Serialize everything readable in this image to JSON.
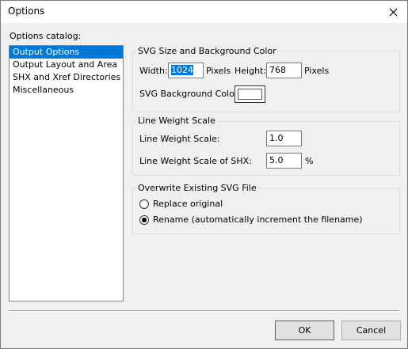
{
  "window": {
    "title": "Options"
  },
  "catalog": {
    "label": "Options catalog:",
    "items": [
      "Output Options",
      "Output Layout and Area",
      "SHX and Xref Directories",
      "Miscellaneous"
    ],
    "selected": "Output Options"
  },
  "svg_size": {
    "title": "SVG Size and Background Color",
    "width_label": "Width:",
    "width_value": "1024",
    "pixels1": "Pixels",
    "height_label": "Height:",
    "height_value": "768",
    "pixels2": "Pixels",
    "bg_label": "SVG Background Color:",
    "bg_color": "#ffffff"
  },
  "line_weight": {
    "title": "Line Weight Scale",
    "scale_label": "Line Weight Scale:",
    "scale_value": "1.0",
    "shx_label": "Line Weight Scale of SHX:",
    "shx_value": "5.0",
    "percent": "%"
  },
  "overwrite": {
    "title": "Overwrite Existing SVG File",
    "option1": "Replace original",
    "option2": "Rename (automatically increment the filename)",
    "selected": "option2"
  },
  "buttons": {
    "ok": "OK",
    "cancel": "Cancel"
  }
}
